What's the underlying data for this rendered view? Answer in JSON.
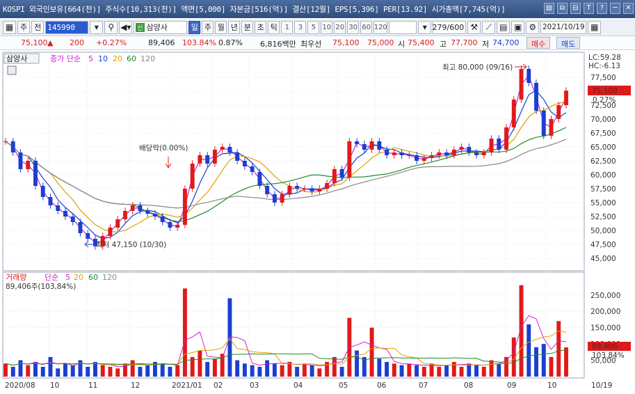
{
  "window": {
    "title": "KOSPI 외국인보유[664(천)] 주식수[10,313(천)] 액면[5,000] 자본금[516(억)] 결산[12월] EPS[5,396] PER[13.92] 시가총액[7,745(억)]",
    "buttons": [
      "▤",
      "⧉",
      "⊟",
      "T",
      "?",
      "─",
      "✕"
    ]
  },
  "toolbar": {
    "market_label": "주",
    "prev_label": "전",
    "stock_code": "145990",
    "stock_badge": "신",
    "stock_name": "삼양사",
    "periods": [
      {
        "label": "일",
        "active": true
      },
      {
        "label": "주",
        "active": false
      },
      {
        "label": "월",
        "active": false
      },
      {
        "label": "년",
        "active": false
      },
      {
        "label": "분",
        "active": false
      },
      {
        "label": "초",
        "active": false
      },
      {
        "label": "틱",
        "active": false
      }
    ],
    "intervals": [
      "1",
      "3",
      "5",
      "10",
      "20",
      "30",
      "60",
      "120"
    ],
    "count": "279/600",
    "date": "2021/10/19"
  },
  "quote": {
    "price": "75,100",
    "change_arrow": "▲",
    "change": "200",
    "change_pct": "+0.27%",
    "volume": "89,406",
    "volume_ratio": "103.84%",
    "turnover": "0.87%",
    "amount": "6,816백만",
    "bid_label": "최우선",
    "bid1": "75,100",
    "bid2": "75,000",
    "open_label": "시",
    "open": "75,400",
    "high_label": "고",
    "high": "77,700",
    "low_label": "저",
    "low": "74,700",
    "buy_label": "매수",
    "sell_label": "매도"
  },
  "price_panel": {
    "stock_tag": "삼양사",
    "legend_label": "종가 단순",
    "ma": [
      {
        "period": "5",
        "color": "#d01fd0"
      },
      {
        "period": "10",
        "color": "#1b3fd0"
      },
      {
        "period": "20",
        "color": "#e0a000"
      },
      {
        "period": "60",
        "color": "#1f8a2a"
      },
      {
        "period": "120",
        "color": "#888888"
      }
    ],
    "lc_label": "LC:59.28",
    "hc_label": "HC:-6.13",
    "current_price": "75,100",
    "current_change": "0.27%",
    "high_annotation": "최고 80,000 (09/16)",
    "low_annotation": "최저 47,150 (10/30)",
    "dividend_annotation": "배당락(0.00%)",
    "y_ticks": [
      "77,500",
      "75,000",
      "72,500",
      "70,000",
      "67,500",
      "65,000",
      "62,500",
      "60,000",
      "57,500",
      "55,000",
      "52,500",
      "50,000",
      "47,500",
      "45,000"
    ]
  },
  "volume_panel": {
    "legend_label": "거래량",
    "ma_label": "단순",
    "ma": [
      {
        "period": "5",
        "color": "#d01fd0"
      },
      {
        "period": "20",
        "color": "#e0a000"
      },
      {
        "period": "60",
        "color": "#1f8a2a"
      },
      {
        "period": "120",
        "color": "#888888"
      }
    ],
    "sub_label": "89,406주(103,84%)",
    "current_volume": "89,406",
    "current_ratio": "103.84%",
    "y_ticks": [
      "250,000",
      "200,000",
      "150,000",
      "100,000",
      "50,000"
    ]
  },
  "x_axis": {
    "labels": [
      "2020/08",
      "10",
      "11",
      "12",
      "2021/01",
      "02",
      "03",
      "04",
      "05",
      "06",
      "07",
      "08",
      "09",
      "10"
    ],
    "right_label": "10/19"
  },
  "chart_data": {
    "type": "candlestick",
    "price_series": [
      66000,
      64000,
      61000,
      62500,
      58000,
      56000,
      54500,
      53500,
      52500,
      51500,
      49500,
      48500,
      47150,
      49000,
      50500,
      52000,
      53500,
      54500,
      53500,
      53000,
      52500,
      51500,
      50500,
      51000,
      57500,
      62000,
      63500,
      62000,
      64500,
      65000,
      64000,
      62500,
      61500,
      60500,
      58000,
      56500,
      55000,
      56500,
      58000,
      57500,
      57500,
      57000,
      57500,
      58500,
      61000,
      59500,
      66000,
      65500,
      64500,
      66000,
      64500,
      63500,
      64000,
      63500,
      63500,
      62500,
      63000,
      63500,
      64000,
      63500,
      64500,
      65000,
      64000,
      63500,
      64000,
      66500,
      64500,
      68500,
      73500,
      79000,
      76500,
      71500,
      67000,
      70000,
      72500,
      75100
    ],
    "volume_series": [
      40000,
      30000,
      50000,
      35000,
      45000,
      30000,
      60000,
      25000,
      40000,
      35000,
      50000,
      30000,
      45000,
      35000,
      30000,
      25000,
      40000,
      50000,
      30000,
      35000,
      45000,
      40000,
      30000,
      35000,
      270000,
      60000,
      80000,
      45000,
      55000,
      70000,
      240000,
      50000,
      40000,
      35000,
      30000,
      50000,
      40000,
      35000,
      45000,
      30000,
      40000,
      35000,
      25000,
      45000,
      60000,
      30000,
      180000,
      80000,
      60000,
      150000,
      55000,
      45000,
      40000,
      35000,
      40000,
      35000,
      30000,
      40000,
      30000,
      35000,
      45000,
      30000,
      40000,
      35000,
      30000,
      50000,
      40000,
      60000,
      120000,
      280000,
      160000,
      90000,
      100000,
      60000,
      170000,
      89406
    ],
    "volume_ylim": [
      0,
      290000
    ],
    "price_ylim": [
      43000,
      80500
    ]
  }
}
